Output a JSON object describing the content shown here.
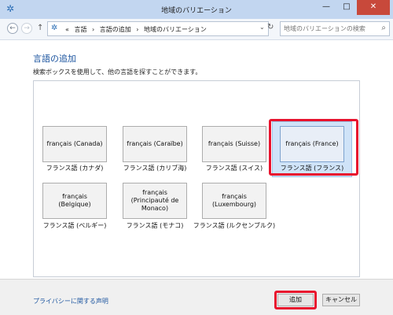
{
  "window": {
    "title": "地域のバリエーション",
    "icon": "globe-clock-icon",
    "controls": {
      "minimize": "—",
      "maximize": "□",
      "close": "✕"
    }
  },
  "nav": {
    "back": "←",
    "forward": "→",
    "up": "↑",
    "address_prefix": "«",
    "breadcrumbs": [
      "言語",
      "言語の追加",
      "地域のバリエーション"
    ],
    "separator": "›",
    "dropdown": "⌄",
    "refresh": "↻",
    "search_placeholder": "地域のバリエーションの検索"
  },
  "main": {
    "title": "言語の追加",
    "description": "検索ボックスを使用して、他の言語を探すことができます。",
    "languages": [
      {
        "label": "français (Canada)",
        "caption": "フランス語 (カナダ)"
      },
      {
        "label": "français (Caraïbe)",
        "caption": "フランス語 (カリブ海)"
      },
      {
        "label": "français (Suisse)",
        "caption": "フランス語 (スイス)"
      },
      {
        "label": "français (France)",
        "caption": "フランス語 (フランス)",
        "selected": true
      },
      {
        "label": "français\n(Belgique)",
        "caption": "フランス語 (ベルギー)"
      },
      {
        "label": "français\n(Principauté de\nMonaco)",
        "caption": "フランス語 (モナコ)"
      },
      {
        "label": "français\n(Luxembourg)",
        "caption": "フランス語 (ルクセンブルク)"
      }
    ]
  },
  "footer": {
    "privacy_link": "プライバシーに関する声明",
    "add_button": "追加",
    "cancel_button": "キャンセル"
  },
  "colors": {
    "accent": "#1e56a0",
    "highlight": "#e8132e",
    "selected_tile": "#cfe3f8"
  }
}
